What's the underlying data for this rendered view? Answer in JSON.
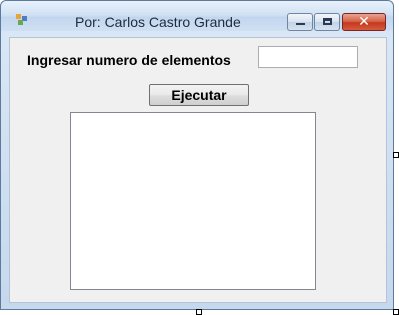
{
  "window": {
    "title": "Por: Carlos Castro Grande",
    "icon": "app-form-icon",
    "controls": {
      "minimize": "minimize-icon",
      "maximize": "maximize-icon",
      "close": "close-icon",
      "close_glyph": "✕"
    }
  },
  "form": {
    "label": "Ingresar numero de elementos",
    "input_value": "",
    "execute_button_label": "Ejecutar",
    "output_text": ""
  }
}
